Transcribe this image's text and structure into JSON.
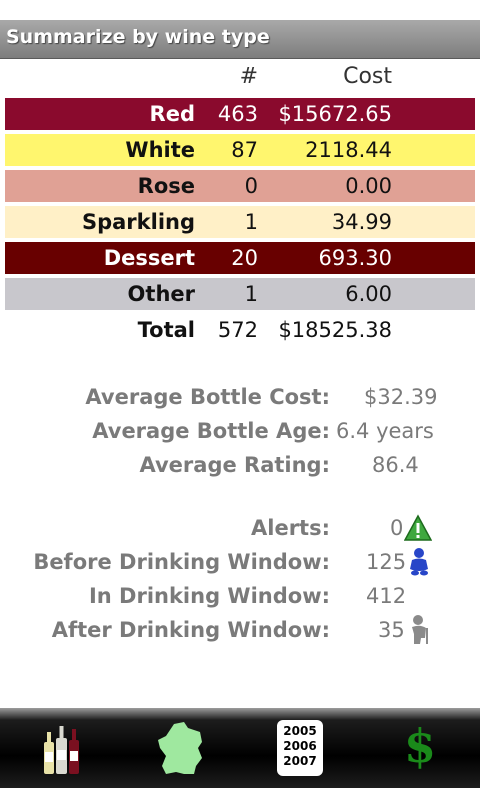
{
  "header": {
    "title": "Summarize by wine type"
  },
  "table": {
    "columns": [
      "",
      "#",
      "Cost"
    ],
    "rows": [
      {
        "name": "Red",
        "count": "463",
        "cost": "$15672.65",
        "bg": "#8a0a2d",
        "fg": "#ffffff"
      },
      {
        "name": "White",
        "count": "87",
        "cost": "2118.44",
        "bg": "#fff66e",
        "fg": "#111111"
      },
      {
        "name": "Rose",
        "count": "0",
        "cost": "0.00",
        "bg": "#e0a195",
        "fg": "#111111"
      },
      {
        "name": "Sparkling",
        "count": "1",
        "cost": "34.99",
        "bg": "#fff0c7",
        "fg": "#111111"
      },
      {
        "name": "Dessert",
        "count": "20",
        "cost": "693.30",
        "bg": "#680000",
        "fg": "#ffffff"
      },
      {
        "name": "Other",
        "count": "1",
        "cost": "6.00",
        "bg": "#c8c7cc",
        "fg": "#111111"
      },
      {
        "name": "Total",
        "count": "572",
        "cost": "$18525.38",
        "bg": "#ffffff",
        "fg": "#111111"
      }
    ]
  },
  "stats": {
    "avg_cost_label": "Average Bottle Cost:",
    "avg_cost": "$32.39",
    "avg_age_label": "Average Bottle Age:",
    "avg_age": "6.4 years",
    "avg_rating_label": "Average Rating:",
    "avg_rating": "86.4"
  },
  "alerts": {
    "alerts_label": "Alerts:",
    "alerts": "0",
    "before_label": "Before Drinking Window:",
    "before": "125",
    "in_label": "In Drinking Window:",
    "in": "412",
    "after_label": "After Drinking Window:",
    "after": "35"
  },
  "toolbar": {
    "years": [
      "2005",
      "2006",
      "2007"
    ],
    "currency_symbol": "$"
  },
  "icons": {
    "alert": "warning-triangle-icon",
    "before": "baby-icon",
    "after": "elderly-icon",
    "bottles": "wine-bottles-icon",
    "region": "france-map-icon",
    "vintage": "vintage-years-icon",
    "cost": "dollar-icon"
  }
}
